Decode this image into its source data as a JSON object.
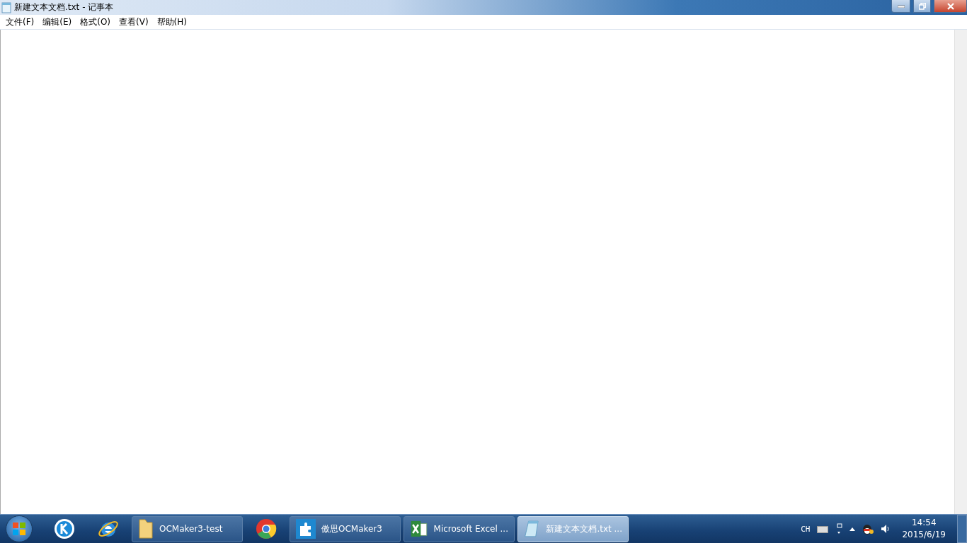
{
  "window": {
    "title": "新建文本文档.txt - 记事本"
  },
  "menu": [
    "文件(F)",
    "编辑(E)",
    "格式(O)",
    "查看(V)",
    "帮助(H)"
  ],
  "taskbar": {
    "items": [
      {
        "kind": "start"
      },
      {
        "kind": "pinned"
      },
      {
        "kind": "pinned"
      },
      {
        "kind": "window",
        "label": "OCMaker3-test",
        "selected": false
      },
      {
        "kind": "pinned"
      },
      {
        "kind": "window",
        "label": "傲思OCMaker3",
        "selected": false
      },
      {
        "kind": "window",
        "label": "Microsoft Excel ...",
        "selected": false
      },
      {
        "kind": "window",
        "label": "新建文本文档.txt ...",
        "selected": true
      }
    ],
    "tray": {
      "language": "CH",
      "time": "14:54",
      "date": "2015/6/19"
    }
  }
}
